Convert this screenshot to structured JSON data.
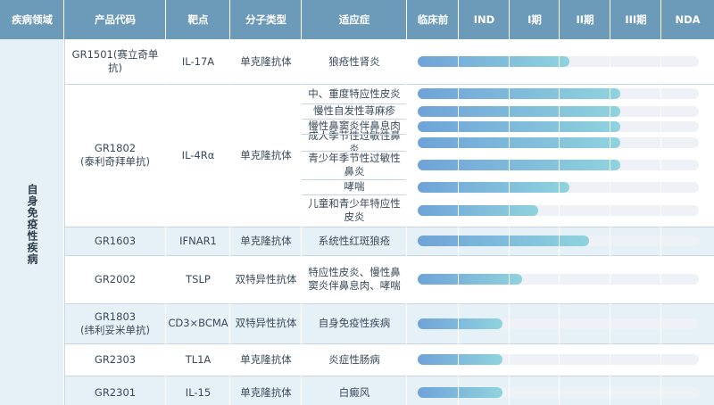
{
  "headers": [
    "疾病领域",
    "产品代码",
    "靶点",
    "分子类型",
    "适应症",
    "临床前",
    "IND",
    "I期",
    "II期",
    "III期",
    "NDA"
  ],
  "domain": "自身免疫性疾病",
  "stages": [
    "临床前",
    "IND",
    "I期",
    "II期",
    "III期",
    "NDA"
  ],
  "products": [
    {
      "code": "GR1501(赛立奇单抗)",
      "target": "IL-17A",
      "type": "单克隆抗体",
      "indications": [
        {
          "name": "狼疮性肾炎",
          "progress": 0.54
        }
      ]
    },
    {
      "code": "GR1802\n(泰利奇拜单抗)",
      "target": "IL-4Rα",
      "type": "单克隆抗体",
      "indications": [
        {
          "name": "中、重度特应性皮炎",
          "progress": 0.72
        },
        {
          "name": "慢性自发性荨麻疹",
          "progress": 0.72
        },
        {
          "name": "慢性鼻窦炎伴鼻息肉",
          "progress": 0.72
        },
        {
          "name": "成人季节性过敏性鼻炎",
          "progress": 0.72
        },
        {
          "name": "青少年季节性过敏性鼻炎",
          "progress": 0.72
        },
        {
          "name": "哮喘",
          "progress": 0.54
        },
        {
          "name": "儿童和青少年特应性皮炎",
          "progress": 0.43
        }
      ]
    },
    {
      "code": "GR1603",
      "target": "IFNAR1",
      "type": "单克隆抗体",
      "indications": [
        {
          "name": "系统性红斑狼疮",
          "progress": 0.61
        }
      ]
    },
    {
      "code": "GR2002",
      "target": "TSLP",
      "type": "双特异性抗体",
      "indications": [
        {
          "name": "特应性皮炎、慢性鼻窦炎伴鼻息肉、哮喘",
          "progress": 0.37
        }
      ]
    },
    {
      "code": "GR1803\n(纬利妥米单抗)",
      "target": "CD3×BCMA",
      "type": "双特异性抗体",
      "indications": [
        {
          "name": "自身免疫性疾病",
          "progress": 0.3
        }
      ]
    },
    {
      "code": "GR2303",
      "target": "TL1A",
      "type": "单克隆抗体",
      "indications": [
        {
          "name": "炎症性肠病",
          "progress": 0.3
        }
      ]
    },
    {
      "code": "GR2301",
      "target": "IL-15",
      "type": "单克隆抗体",
      "indications": [
        {
          "name": "白癜风",
          "progress": 0.3
        }
      ]
    }
  ]
}
